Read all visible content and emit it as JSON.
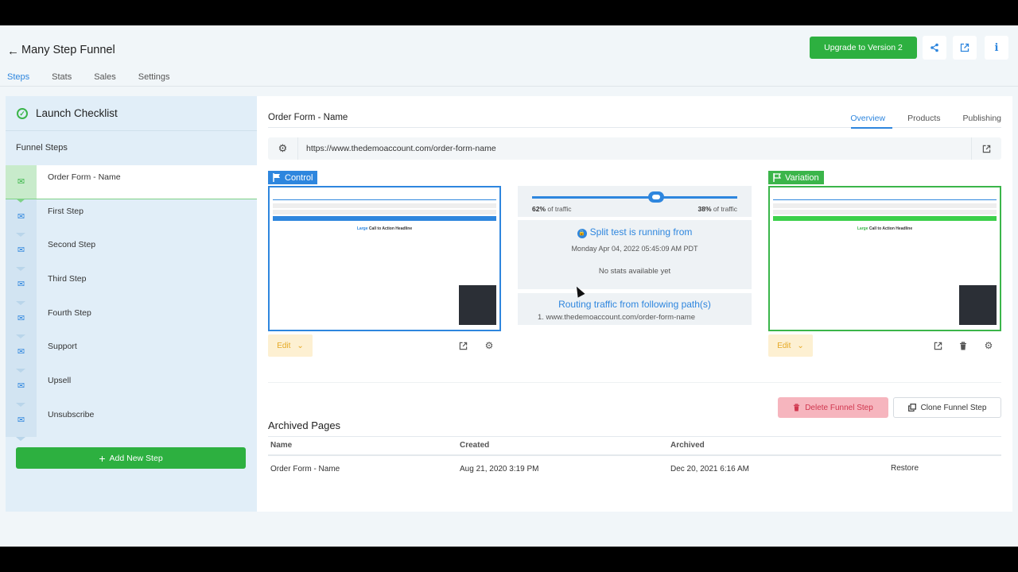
{
  "header": {
    "back_icon": "←",
    "title": "Many Step Funnel",
    "upgrade_label": "Upgrade to Version 2",
    "nav": [
      "Steps",
      "Stats",
      "Sales",
      "Settings"
    ]
  },
  "sidebar": {
    "launch_checklist": "Launch Checklist",
    "funnel_steps_label": "Funnel Steps",
    "steps": [
      "Order Form - Name",
      "First Step",
      "Second Step",
      "Third Step",
      "Fourth Step",
      "Support",
      "Upsell",
      "Unsubscribe"
    ],
    "active_step": 0,
    "add_step_label": "Add New Step"
  },
  "main": {
    "page_title": "Order Form - Name",
    "tabs": [
      "Overview",
      "Products",
      "Publishing"
    ],
    "url": "https://www.thedemoaccount.com/order-form-name",
    "control_label": "Control",
    "variation_label": "Variation",
    "edit_label": "Edit",
    "preview_headline_accent": "Large",
    "preview_headline": "Call to Action Headline",
    "split": {
      "control_pct": "62%",
      "variation_pct": "38%",
      "traffic_suffix": "of traffic",
      "running_title": "Split test is running from",
      "running_date": "Monday Apr 04, 2022 05:45:09 AM PDT",
      "no_stats": "No stats available yet",
      "routing_title": "Routing traffic from following path(s)",
      "routing_path": "1. www.thedemoaccount.com/order-form-name"
    },
    "delete_label": "Delete Funnel Step",
    "clone_label": "Clone Funnel Step",
    "archived": {
      "title": "Archived Pages",
      "columns": [
        "Name",
        "Created",
        "Archived"
      ],
      "rows": [
        {
          "name": "Order Form - Name",
          "created": "Aug 21, 2020 3:19 PM",
          "archived": "Dec 20, 2021 6:16 AM",
          "action": "Restore"
        }
      ]
    }
  },
  "colors": {
    "accent_blue": "#2e86de",
    "green": "#2db040",
    "delete_pink": "#f6b5be",
    "edit_yellow": "#fdf0d2"
  },
  "icons": [
    "back-arrow-icon",
    "share-icon",
    "external-link-icon",
    "info-icon",
    "check-circle-icon",
    "mail-icon",
    "plus-icon",
    "gear-icon",
    "flag-icon",
    "chevron-down-icon",
    "trash-icon",
    "clone-icon",
    "lock-icon"
  ]
}
